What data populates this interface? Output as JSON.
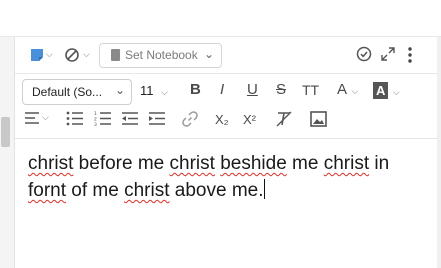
{
  "toolbar_top": {
    "notebook_label": "Set Notebook"
  },
  "format_bar": {
    "font_family": "Default (So...",
    "font_size": "11",
    "bold": "B",
    "italic": "I",
    "underline": "U",
    "strike": "S",
    "text_size": "TT",
    "font_color": "A",
    "highlight": "A",
    "subscript": "X₂",
    "superscript": "X²"
  },
  "note": {
    "segments": [
      {
        "text": "christ",
        "misspelled": true
      },
      {
        "text": " before me ",
        "misspelled": false
      },
      {
        "text": "christ",
        "misspelled": true
      },
      {
        "text": " ",
        "misspelled": false
      },
      {
        "text": "beshide",
        "misspelled": true
      },
      {
        "text": " me ",
        "misspelled": false
      },
      {
        "text": "christ",
        "misspelled": true
      },
      {
        "text": " in ",
        "misspelled": false
      },
      {
        "text": "fornt",
        "misspelled": true
      },
      {
        "text": " of me ",
        "misspelled": false
      },
      {
        "text": "christ",
        "misspelled": true
      },
      {
        "text": " above me.",
        "misspelled": false
      }
    ]
  }
}
